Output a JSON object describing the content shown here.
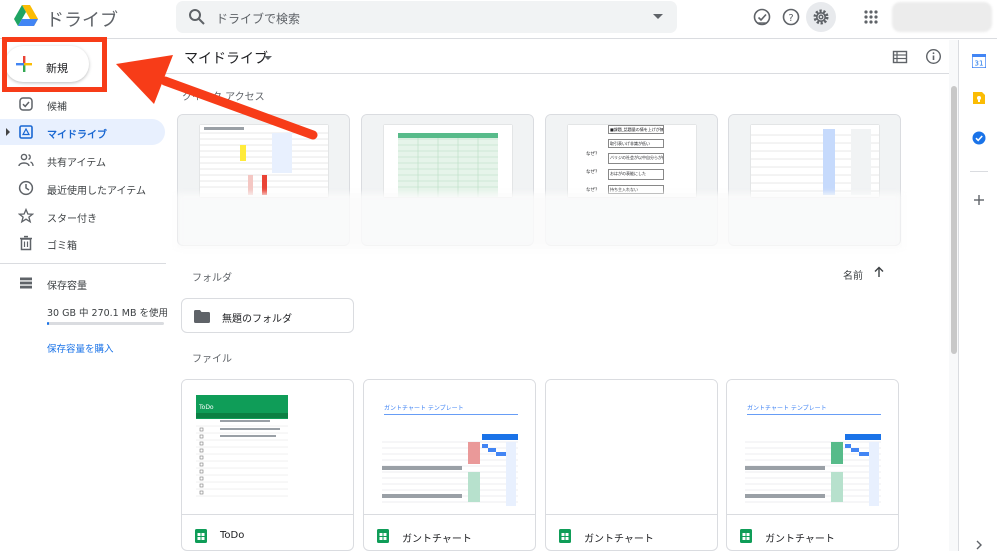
{
  "app": {
    "brand": "ドライブ"
  },
  "search": {
    "placeholder": "ドライブで検索"
  },
  "sidebar": {
    "new_label": "新規",
    "items": [
      {
        "label": "候補",
        "icon": "check-circle-icon"
      },
      {
        "label": "マイドライブ",
        "icon": "my-drive-icon",
        "active": true
      },
      {
        "label": "共有アイテム",
        "icon": "shared-people-icon"
      },
      {
        "label": "最近使用したアイテム",
        "icon": "clock-icon"
      },
      {
        "label": "スター付き",
        "icon": "star-icon"
      },
      {
        "label": "ゴミ箱",
        "icon": "trash-icon"
      }
    ],
    "storage": {
      "label": "保存容量",
      "usage_text": "30 GB 中 270.1 MB を使用",
      "used_fraction": 0.009,
      "buy_label": "保存容量を購入"
    }
  },
  "main": {
    "title": "マイドライブ",
    "quick_access_label": "クイック アクセス",
    "folders_label": "フォルダ",
    "sort_label": "名前",
    "folders": [
      {
        "name": "無題のフォルダ"
      }
    ],
    "files_label": "ファイル",
    "files": [
      {
        "name": "ToDo",
        "type": "sheets",
        "thumb_title": "ToDo"
      },
      {
        "name": "ガントチャート",
        "type": "sheets",
        "thumb_title": "ガントチャート テンプレート"
      },
      {
        "name": "ガントチャート",
        "type": "sheets",
        "thumb_title": ""
      },
      {
        "name": "ガントチャート",
        "type": "sheets",
        "thumb_title": "ガントチャート テンプレート"
      }
    ],
    "quick_access_doc": {
      "rows": [
        "■課題_話題量の情を上げが無がない",
        "取引表いげ非識が低い",
        "バリジの社会が以中自分らが低い",
        "おはがの表能にした",
        "持ち主入れない"
      ],
      "why_label": "なぜ？"
    }
  },
  "colors": {
    "accent": "#1a73e8",
    "annotation": "#f73c18",
    "active_bg": "#e8f0fe",
    "sheets_green": "#0f9d58"
  },
  "rightbar": {
    "calendar_day": "31"
  }
}
